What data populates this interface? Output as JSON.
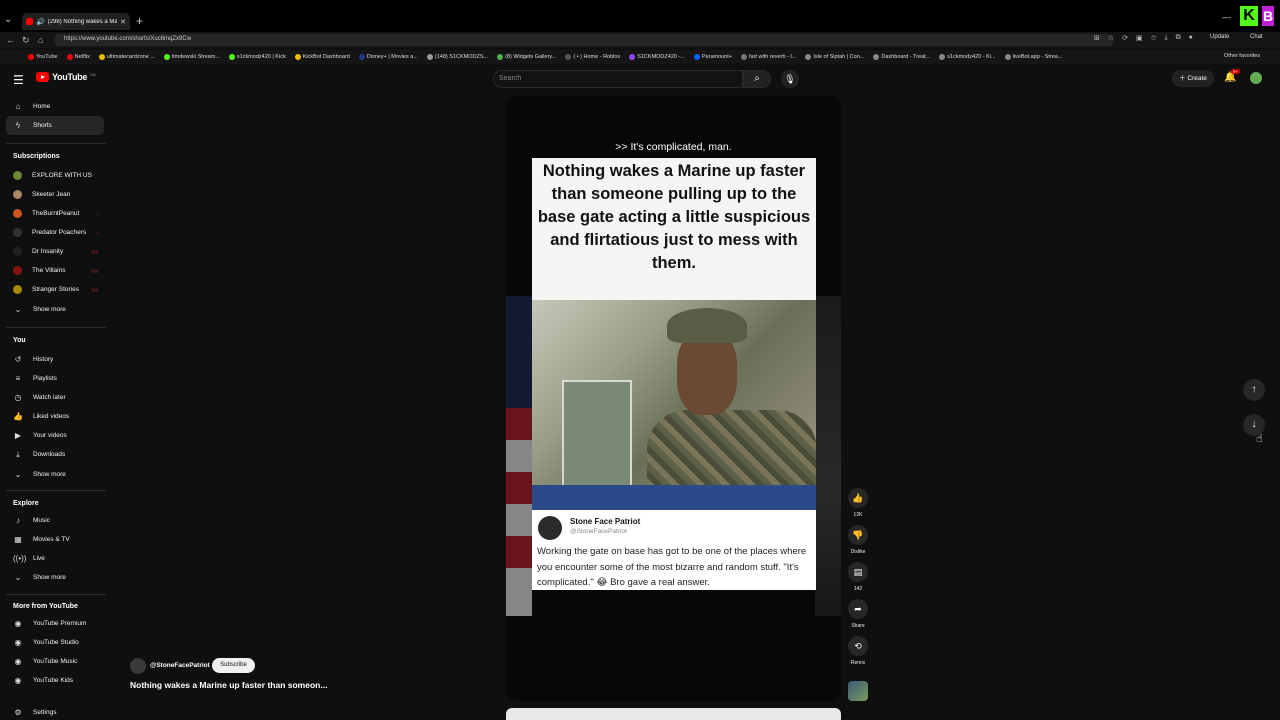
{
  "browser": {
    "tab_title": "(298) Nothing wakes a Marine",
    "url": "https://www.youtube.com/shorts/Xuc6mqZx9Cw",
    "update_label": "Update",
    "chat_label": "Chat",
    "other_favorites": "Other favorites",
    "bookmarks": [
      {
        "label": "YouTube",
        "color": "#ff0000"
      },
      {
        "label": "Netflix",
        "color": "#e50914"
      },
      {
        "label": "ultimatecardzone ...",
        "color": "#e6c200"
      },
      {
        "label": "timdewski Stream...",
        "color": "#53fc18"
      },
      {
        "label": "s1ckmodz420 | Kick",
        "color": "#53fc18"
      },
      {
        "label": "KickBot Dashboard",
        "color": "#f0c000"
      },
      {
        "label": "Disney+ | Movies a...",
        "color": "#1f3a8a"
      },
      {
        "label": "(148) S1CKMODZS...",
        "color": "#999999"
      },
      {
        "label": "(8) Widgets Gallery...",
        "color": "#4caf50"
      },
      {
        "label": "( • ) Home - Roblox",
        "color": "#555555"
      },
      {
        "label": "S1CKMODZ420 -...",
        "color": "#9146ff"
      },
      {
        "label": "Paramount+",
        "color": "#0064ff"
      },
      {
        "label": "fart with reverb - I...",
        "color": "#777777"
      },
      {
        "label": "Isle of Siptah | Con...",
        "color": "#888888"
      },
      {
        "label": "Dashboard - Treat...",
        "color": "#888888"
      },
      {
        "label": "s1ckmodz420 - Ki...",
        "color": "#888888"
      },
      {
        "label": "liveBot.app - Strea...",
        "color": "#888888"
      }
    ]
  },
  "header": {
    "logo_text": "YouTube",
    "country_code": "CA",
    "search_placeholder": "Search",
    "create_label": "Create",
    "notification_count": "9+"
  },
  "sidebar": {
    "main": [
      {
        "label": "Home",
        "icon": "home-icon"
      },
      {
        "label": "Shorts",
        "icon": "shorts-icon"
      }
    ],
    "subscriptions_heading": "Subscriptions",
    "subscriptions": [
      {
        "label": "EXPLORE WITH US",
        "live": "",
        "color": "#6a8a3a"
      },
      {
        "label": "Skeeter Jean",
        "live": "",
        "color": "#aa8866"
      },
      {
        "label": "TheBurntPeanut",
        "live": "•",
        "color": "#cc5522"
      },
      {
        "label": "Predator Poachers",
        "live": "•",
        "color": "#333333"
      },
      {
        "label": "Dr Insanity",
        "live": "((•))",
        "color": "#222222"
      },
      {
        "label": "The Villains",
        "live": "((•))",
        "color": "#881111"
      },
      {
        "label": "Stranger Stories",
        "live": "((•))",
        "color": "#aa8800"
      }
    ],
    "show_more": "Show more",
    "you_heading": "You",
    "you_items": [
      {
        "label": "History",
        "icon": "history-icon"
      },
      {
        "label": "Playlists",
        "icon": "playlists-icon"
      },
      {
        "label": "Watch later",
        "icon": "watch-later-icon"
      },
      {
        "label": "Liked videos",
        "icon": "liked-videos-icon"
      },
      {
        "label": "Your videos",
        "icon": "your-videos-icon"
      },
      {
        "label": "Downloads",
        "icon": "downloads-icon"
      }
    ],
    "explore_heading": "Explore",
    "explore_items": [
      {
        "label": "Music",
        "icon": "music-icon"
      },
      {
        "label": "Movies & TV",
        "icon": "movies-icon"
      },
      {
        "label": "Live",
        "icon": "live-icon"
      }
    ],
    "more_heading": "More from YouTube",
    "more_items": [
      {
        "label": "YouTube Premium"
      },
      {
        "label": "YouTube Studio"
      },
      {
        "label": "YouTube Music"
      },
      {
        "label": "YouTube Kids"
      }
    ],
    "settings": "Settings"
  },
  "short": {
    "caption": ">> It's complicated, man.",
    "title_card": "Nothing wakes a Marine up faster than someone pulling up to the base gate acting a little suspicious and flirtatious just to mess with them.",
    "tweet_name": "Stone Face Patriot",
    "tweet_handle": "@StoneFacePatriot",
    "tweet_text": "Working the gate on base has got to be one of the places where you encounter some of the most bizarre and random stuff. \"It's complicated.\" 😂 Bro gave a real answer.",
    "channel": "@StoneFacePatriot",
    "subscribe": "Subscribe",
    "title": "Nothing wakes a Marine up faster than someon..."
  },
  "actions": {
    "likes": "12K",
    "dislike": "Dislike",
    "comments": "142",
    "share": "Share",
    "remix": "Remix"
  }
}
